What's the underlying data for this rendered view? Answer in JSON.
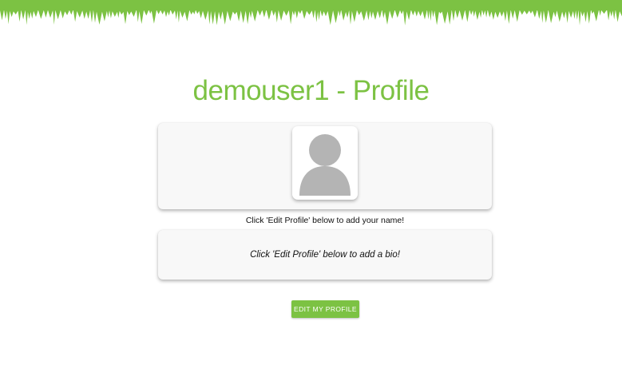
{
  "header": {
    "banner_icon": "grass-icon",
    "banner_color": "#7cc243"
  },
  "profile": {
    "title": "demouser1 - Profile",
    "avatar_icon": "user-silhouette-icon",
    "name_hint": "Click 'Edit Profile' below to add your name!",
    "bio_hint": "Click 'Edit Profile' below to add a bio!",
    "edit_button_label": "EDIT MY PROFILE"
  },
  "colors": {
    "accent": "#7cc243",
    "card_background": "#f8f8f8",
    "avatar_gray": "#b4b4b4"
  }
}
